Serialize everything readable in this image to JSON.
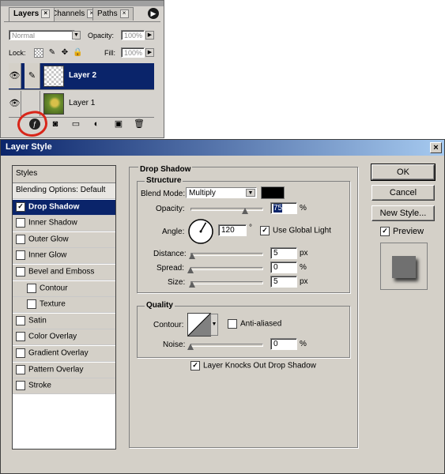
{
  "layers_panel": {
    "tabs": [
      "Layers",
      "Channels",
      "Paths"
    ],
    "blend_mode": "Normal",
    "opacity_label": "Opacity:",
    "opacity_value": "100%",
    "lock_label": "Lock:",
    "fill_label": "Fill:",
    "fill_value": "100%",
    "layers": [
      {
        "name": "Layer 2",
        "selected": true
      },
      {
        "name": "Layer 1",
        "selected": false
      }
    ]
  },
  "dialog": {
    "title": "Layer Style",
    "close": "×",
    "styles_header": "Styles",
    "style_items": [
      {
        "label": "Blending Options: Default",
        "checkbox": false,
        "checked": false,
        "indent": false
      },
      {
        "label": "Drop Shadow",
        "checkbox": true,
        "checked": true,
        "indent": false
      },
      {
        "label": "Inner Shadow",
        "checkbox": true,
        "checked": false,
        "indent": false
      },
      {
        "label": "Outer Glow",
        "checkbox": true,
        "checked": false,
        "indent": false
      },
      {
        "label": "Inner Glow",
        "checkbox": true,
        "checked": false,
        "indent": false
      },
      {
        "label": "Bevel and Emboss",
        "checkbox": true,
        "checked": false,
        "indent": false
      },
      {
        "label": "Contour",
        "checkbox": true,
        "checked": false,
        "indent": true
      },
      {
        "label": "Texture",
        "checkbox": true,
        "checked": false,
        "indent": true
      },
      {
        "label": "Satin",
        "checkbox": true,
        "checked": false,
        "indent": false
      },
      {
        "label": "Color Overlay",
        "checkbox": true,
        "checked": false,
        "indent": false
      },
      {
        "label": "Gradient Overlay",
        "checkbox": true,
        "checked": false,
        "indent": false
      },
      {
        "label": "Pattern Overlay",
        "checkbox": true,
        "checked": false,
        "indent": false
      },
      {
        "label": "Stroke",
        "checkbox": true,
        "checked": false,
        "indent": false
      }
    ],
    "drop_shadow": {
      "title": "Drop Shadow",
      "structure_title": "Structure",
      "blend_mode_label": "Blend Mode:",
      "blend_mode_value": "Multiply",
      "shadow_color": "#000000",
      "opacity_label": "Opacity:",
      "opacity_value": "75",
      "opacity_unit": "%",
      "opacity_fraction": 0.75,
      "angle_label": "Angle:",
      "angle_value": "120",
      "angle_unit": "°",
      "use_global_light_label": "Use Global Light",
      "use_global_light_checked": true,
      "distance_label": "Distance:",
      "distance_value": "5",
      "distance_unit": "px",
      "spread_label": "Spread:",
      "spread_value": "0",
      "spread_unit": "%",
      "size_label": "Size:",
      "size_value": "5",
      "size_unit": "px",
      "quality_title": "Quality",
      "contour_label": "Contour:",
      "anti_aliased_label": "Anti-aliased",
      "anti_aliased_checked": false,
      "noise_label": "Noise:",
      "noise_value": "0",
      "noise_unit": "%",
      "knockout_label": "Layer Knocks Out Drop Shadow",
      "knockout_checked": true
    },
    "buttons": {
      "ok": "OK",
      "cancel": "Cancel",
      "new_style": "New Style..."
    },
    "preview_label": "Preview",
    "preview_checked": true
  },
  "colors": {
    "selection": "#0a246a",
    "annotation_ring": "#d8261a",
    "dialog_bg": "#d4d0c8"
  }
}
